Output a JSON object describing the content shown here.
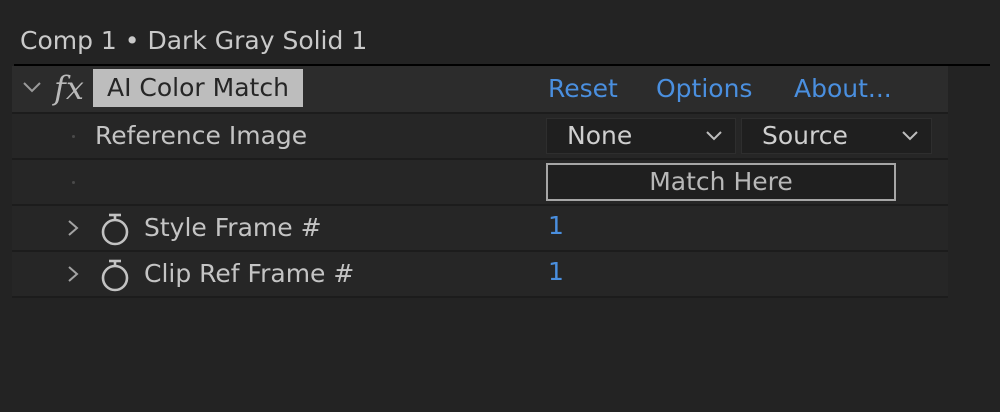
{
  "panel": {
    "title": "Comp 1 • Dark Gray Solid 1"
  },
  "effect": {
    "icon": "fx-icon",
    "name": "AI Color Match",
    "links": {
      "reset": "Reset",
      "options": "Options",
      "about": "About..."
    }
  },
  "properties": {
    "reference_image": {
      "label": "Reference Image",
      "layer_select": "None",
      "source_select": "Source"
    },
    "match_button": "Match Here",
    "style_frame": {
      "label": "Style Frame #",
      "value": "1"
    },
    "clip_ref_frame": {
      "label": "Clip Ref Frame #",
      "value": "1"
    }
  },
  "colors": {
    "link": "#4a8fdf",
    "background": "#232323",
    "effect_name_bg": "#bdbdbd"
  }
}
